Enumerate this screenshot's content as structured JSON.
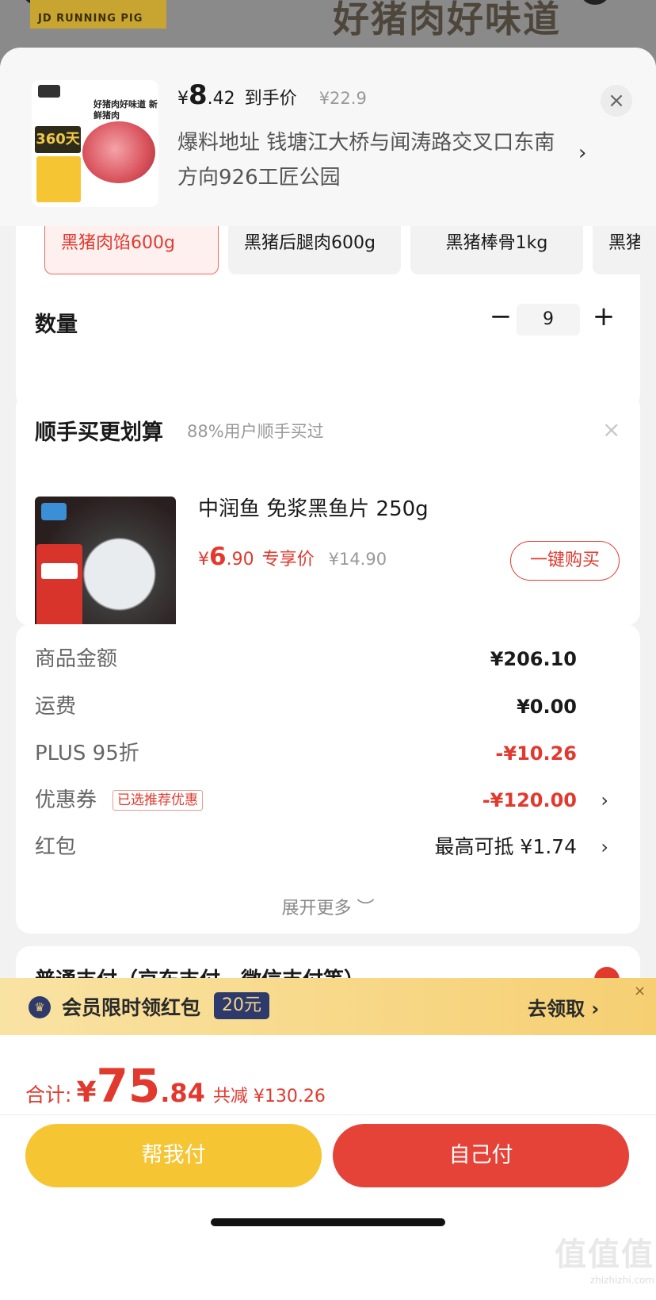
{
  "background": {
    "brand_logo": "JD RUNNING PIG",
    "slogan": "好猪肉好味道"
  },
  "header": {
    "price_currency": "¥",
    "price_integer": "8",
    "price_decimal": ".42",
    "price_tag": "到手价",
    "original_price": "¥22.9",
    "address": "爆料地址  钱塘江大桥与闻涛路交叉口东南方向926工匠公园",
    "address_arrow": "›",
    "close": "×",
    "thumb_title": "好猪肉好味道 新鲜猪肉",
    "thumb_badge": "360天"
  },
  "spec": {
    "options": [
      {
        "label": "黑猪肉馅600g",
        "selected": true
      },
      {
        "label": "黑猪后腿肉600g",
        "selected": false
      },
      {
        "label": "黑猪棒骨1kg",
        "selected": false
      },
      {
        "label": "黑猪",
        "selected": false
      }
    ],
    "quantity_label": "数量",
    "quantity_minus": "−",
    "quantity_value": "9",
    "quantity_plus": "+"
  },
  "bundle": {
    "title": "顺手买更划算",
    "subtitle": "88%用户顺手买过",
    "close": "×",
    "product_name": "中润鱼 免浆黑鱼片 250g",
    "price_currency": "¥",
    "price_integer": "6",
    "price_decimal": ".90",
    "price_tag": "专享价",
    "original_price": "¥14.90",
    "buy_button": "一键购买"
  },
  "summary": {
    "rows": [
      {
        "label": "商品金额",
        "value": "¥206.10"
      },
      {
        "label": "运费",
        "value": "¥0.00"
      },
      {
        "label": "PLUS 95折",
        "value": "-¥10.26"
      },
      {
        "label": "优惠券",
        "badge": "已选推荐优惠",
        "value": "-¥120.00",
        "arrow": "›"
      },
      {
        "label": "红包",
        "value": "最高可抵 ¥1.74",
        "arrow": "›"
      }
    ],
    "expand": "展开更多 ︶"
  },
  "payment": {
    "method_text": "普通支付（京东支付、微信支付等）"
  },
  "member_banner": {
    "icon": "♛",
    "text": "会员限时领红包",
    "badge": "20元",
    "action": "去领取 ›",
    "close": "×"
  },
  "footer": {
    "total_label": "合计:",
    "total_currency": "¥",
    "total_integer": "75",
    "total_decimal": ".84",
    "saved": "共减 ¥130.26",
    "help_pay": "帮我付",
    "self_pay": "自己付"
  },
  "watermark": {
    "logo": "值值值",
    "site": "zhizhizhi.com"
  },
  "colors": {
    "accent_red": "#e2392e",
    "accent_yellow": "#f5c533",
    "member_navy": "#2d3a6b"
  }
}
